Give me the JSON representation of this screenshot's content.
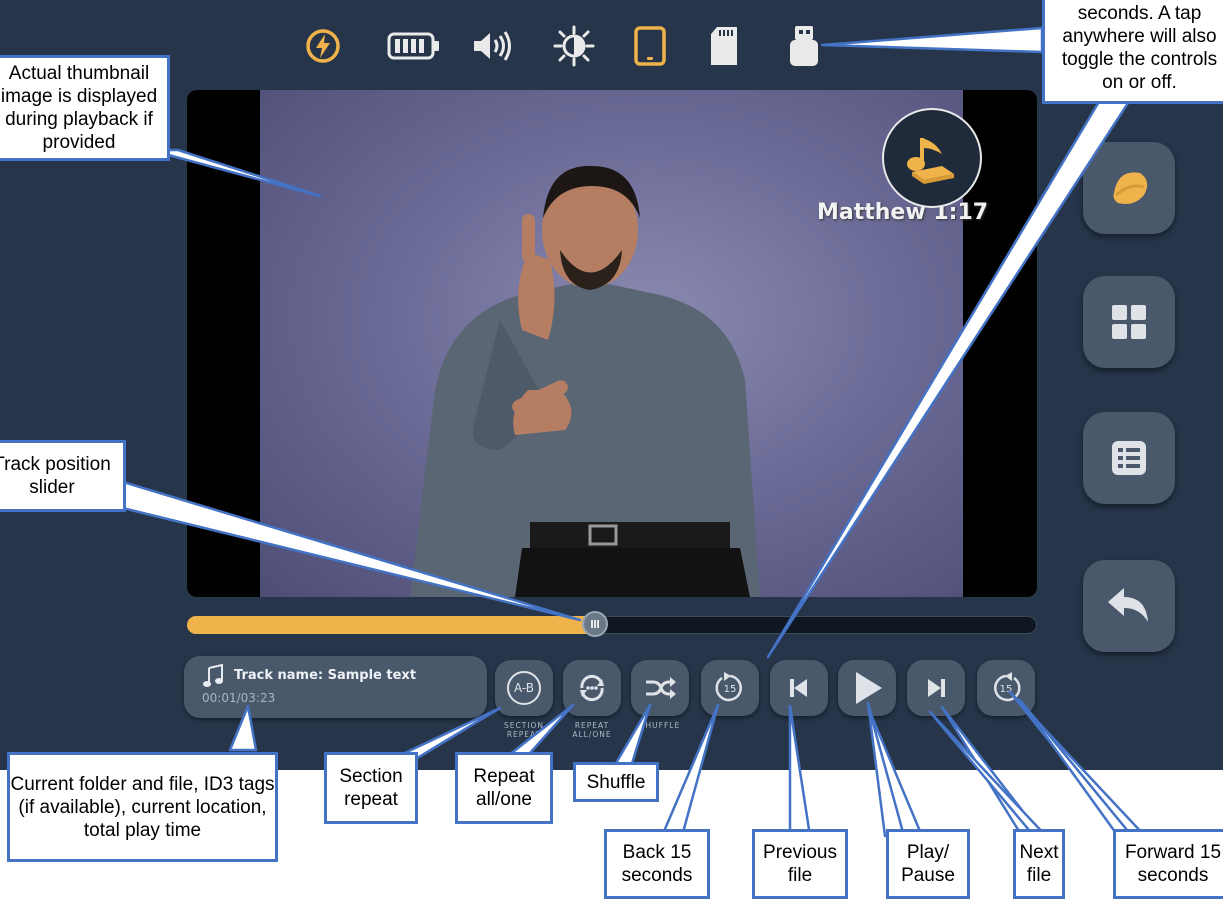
{
  "status_bar": {
    "icons": [
      "power-icon",
      "battery-icon",
      "volume-icon",
      "brightness-icon",
      "tablet-icon",
      "sd-card-icon",
      "usb-icon"
    ]
  },
  "video": {
    "verse": "Matthew 1:17"
  },
  "side_buttons": [
    "app-mode-icon",
    "grid-icon",
    "list-icon",
    "back-icon"
  ],
  "progress": {
    "position_fraction": 0.48
  },
  "track": {
    "name": "Track name: Sample text",
    "time": "00:01/03:23"
  },
  "controls": {
    "section_repeat_badge": "A-B",
    "section_repeat_label": "SECTION REPEAT",
    "repeat_label": "REPEAT ALL/ONE",
    "shuffle_label": "SHUFFLE",
    "back_15_badge": "15",
    "forward_15_badge": "15"
  },
  "callouts": {
    "thumbnail": "Actual thumbnail image is displayed during playback if provided",
    "controls_toggle": "seconds. A tap anywhere will also toggle the controls on or off.",
    "track_slider": "Track position slider",
    "folder_info": "Current folder and file, ID3 tags (if available), current location, total play time",
    "section_repeat": "Section repeat",
    "repeat_all_one": "Repeat all/one",
    "shuffle": "Shuffle",
    "back_15": "Back 15 seconds",
    "previous_file": "Previous file",
    "play_pause": "Play/ Pause",
    "next_file": "Next file",
    "forward_15": "Forward 15 seconds"
  },
  "colors": {
    "background": "#263549",
    "accent": "#f0b24a",
    "button": "#4a586c",
    "callout_border": "#4472c4"
  }
}
